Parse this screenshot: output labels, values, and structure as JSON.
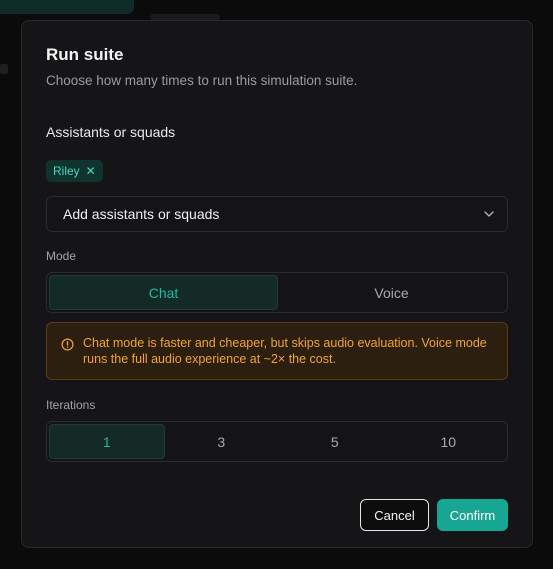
{
  "modal": {
    "title": "Run suite",
    "subtitle": "Choose how many times to run this simulation suite."
  },
  "assistants": {
    "label": "Assistants or squads",
    "chips": [
      {
        "label": "Riley",
        "remove_icon": "close-icon"
      }
    ],
    "select_placeholder": "Add assistants or squads",
    "select_icon": "chevron-down-icon"
  },
  "mode": {
    "label": "Mode",
    "options": [
      "Chat",
      "Voice"
    ],
    "selected": "Chat"
  },
  "warning": {
    "icon": "alert-circle-icon",
    "text": "Chat mode is faster and cheaper, but skips audio evaluation. Voice mode runs the full audio experience at ~2× the cost."
  },
  "iterations": {
    "label": "Iterations",
    "options": [
      "1",
      "3",
      "5",
      "10"
    ],
    "selected": "1"
  },
  "footer": {
    "cancel_label": "Cancel",
    "confirm_label": "Confirm"
  },
  "colors": {
    "accent": "#17a594",
    "warning_text": "#f0a23c",
    "chip_bg": "#10332e"
  }
}
